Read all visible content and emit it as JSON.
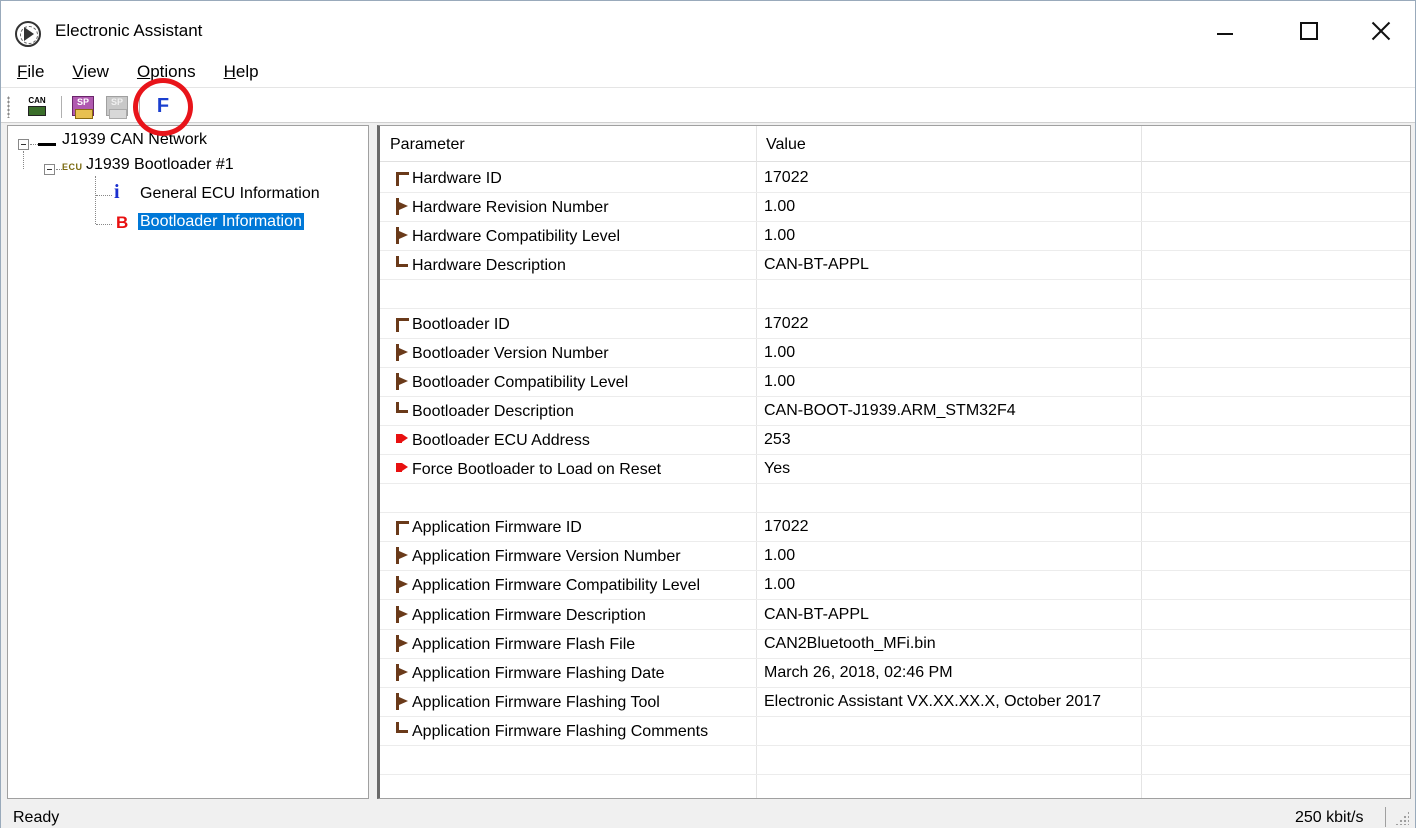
{
  "window": {
    "title": "Electronic Assistant"
  },
  "menu": {
    "file": {
      "pre": "",
      "u": "F",
      "post": "ile"
    },
    "view": {
      "pre": "",
      "u": "V",
      "post": "iew"
    },
    "options": {
      "pre": "",
      "u": "O",
      "post": "ptions"
    },
    "help": {
      "pre": "",
      "u": "H",
      "post": "elp"
    }
  },
  "toolbar": {
    "can_icon_text": "CAN",
    "sp_icon_text": "SP",
    "sp_disabled_icon_text": "SP",
    "flash_icon_text": "F"
  },
  "tree": {
    "network_label": "J1939 CAN Network",
    "ecu_badge": "ECU",
    "ecu_label": "J1939 Bootloader #1",
    "info_glyph": "i",
    "info_label": "General ECU Information",
    "boot_glyph": "B",
    "boot_label": "Bootloader Information"
  },
  "grid": {
    "columns": {
      "parameter": "Parameter",
      "value": "Value"
    },
    "rows": [
      {
        "param": "Hardware ID",
        "value": "17022",
        "glyph": "first"
      },
      {
        "param": "Hardware Revision Number",
        "value": "1.00",
        "glyph": "mid"
      },
      {
        "param": "Hardware Compatibility Level",
        "value": "1.00",
        "glyph": "mid"
      },
      {
        "param": "Hardware Description",
        "value": "CAN-BT-APPL",
        "glyph": "last"
      },
      {
        "param": "",
        "value": "",
        "glyph": "none"
      },
      {
        "param": "Bootloader ID",
        "value": "17022",
        "glyph": "first"
      },
      {
        "param": "Bootloader Version Number",
        "value": "1.00",
        "glyph": "mid"
      },
      {
        "param": "Bootloader Compatibility Level",
        "value": "1.00",
        "glyph": "mid"
      },
      {
        "param": "Bootloader Description",
        "value": "CAN-BOOT-J1939.ARM_STM32F4",
        "glyph": "last"
      },
      {
        "param": "Bootloader ECU Address",
        "value": "253",
        "glyph": "red"
      },
      {
        "param": "Force Bootloader to Load on Reset",
        "value": "Yes",
        "glyph": "red"
      },
      {
        "param": "",
        "value": "",
        "glyph": "none"
      },
      {
        "param": "Application Firmware ID",
        "value": "17022",
        "glyph": "first"
      },
      {
        "param": "Application Firmware Version Number",
        "value": "1.00",
        "glyph": "mid"
      },
      {
        "param": "Application Firmware Compatibility Level",
        "value": "1.00",
        "glyph": "mid"
      },
      {
        "param": "Application Firmware Description",
        "value": "CAN-BT-APPL",
        "glyph": "mid"
      },
      {
        "param": "Application Firmware Flash File",
        "value": "CAN2Bluetooth_MFi.bin",
        "glyph": "mid"
      },
      {
        "param": "Application Firmware Flashing Date",
        "value": "March 26, 2018, 02:46 PM",
        "glyph": "mid"
      },
      {
        "param": "Application Firmware Flashing Tool",
        "value": "Electronic Assistant VX.XX.XX.X, October 2017",
        "glyph": "mid"
      },
      {
        "param": "Application Firmware Flashing Comments",
        "value": "",
        "glyph": "last"
      },
      {
        "param": "",
        "value": "",
        "glyph": "none"
      }
    ]
  },
  "status": {
    "text": "Ready",
    "bitrate": "250 kbit/s"
  },
  "colors": {
    "selection": "#0078d7",
    "highlight_ring": "#e8141a",
    "flash_icon": "#1a3fcf",
    "tree_bullet": "#6a3a1a",
    "writable_bullet": "#e81010"
  }
}
